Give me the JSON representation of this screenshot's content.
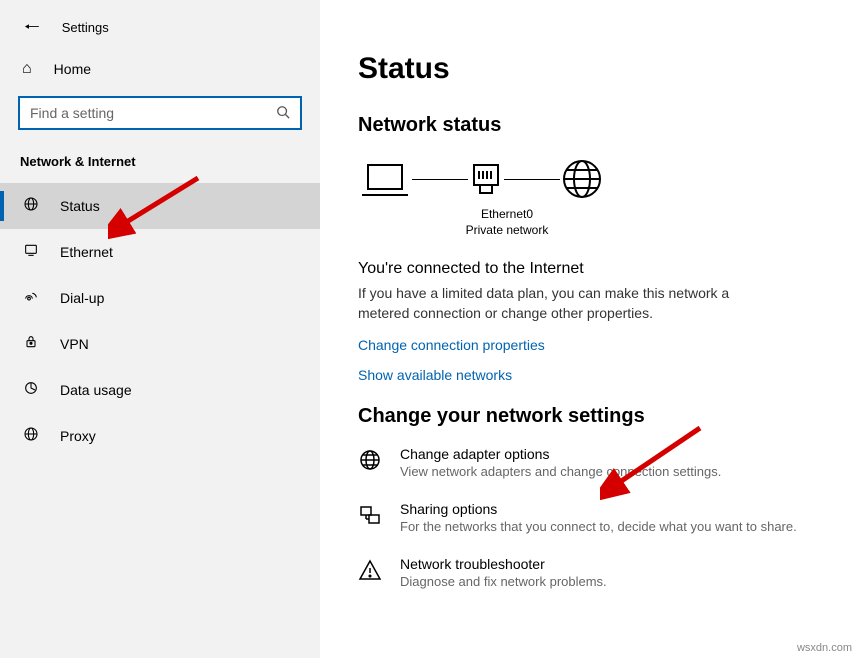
{
  "app_title": "Settings",
  "home_label": "Home",
  "search_placeholder": "Find a setting",
  "category": "Network & Internet",
  "nav": [
    {
      "label": "Status",
      "icon": "⊕"
    },
    {
      "label": "Ethernet",
      "icon": "🖥"
    },
    {
      "label": "Dial-up",
      "icon": "📞"
    },
    {
      "label": "VPN",
      "icon": "⚬"
    },
    {
      "label": "Data usage",
      "icon": "◔"
    },
    {
      "label": "Proxy",
      "icon": "⊕"
    }
  ],
  "page_title": "Status",
  "section_title": "Network status",
  "diagram_label_line1": "Ethernet0",
  "diagram_label_line2": "Private network",
  "connected_title": "You're connected to the Internet",
  "connected_desc": "If you have a limited data plan, you can make this network a metered connection or change other properties.",
  "link_change_props": "Change connection properties",
  "link_show_networks": "Show available networks",
  "section_title2": "Change your network settings",
  "options": [
    {
      "icon": "globe",
      "title": "Change adapter options",
      "desc": "View network adapters and change connection settings."
    },
    {
      "icon": "share",
      "title": "Sharing options",
      "desc": "For the networks that you connect to, decide what you want to share."
    },
    {
      "icon": "warn",
      "title": "Network troubleshooter",
      "desc": "Diagnose and fix network problems."
    }
  ],
  "watermark": "wsxdn.com"
}
